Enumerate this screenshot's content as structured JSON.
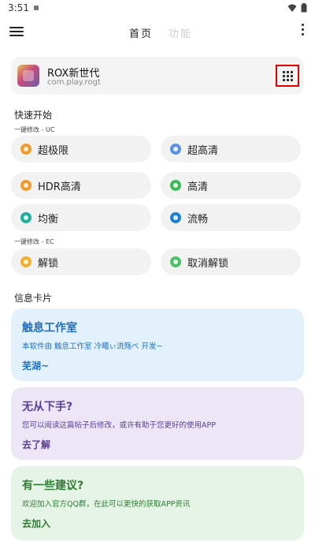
{
  "status_bar": {
    "time": "3:51"
  },
  "app_bar": {
    "tabs": [
      {
        "label": "首页"
      },
      {
        "label": "功能"
      }
    ]
  },
  "target_app": {
    "name": "ROX新世代",
    "package": "com.play.rogt"
  },
  "quick_start": {
    "title": "快速开始",
    "group_uc": {
      "label": "一键修改 - UC",
      "items": [
        {
          "label": "超极限",
          "color": "#f39a2b"
        },
        {
          "label": "超高清",
          "color": "#5b8fe8"
        },
        {
          "label": "HDR高清",
          "color": "#f39a2b"
        },
        {
          "label": "高清",
          "color": "#3dba5a"
        },
        {
          "label": "均衡",
          "color": "#1fae9a"
        },
        {
          "label": "流畅",
          "color": "#1e7fd4"
        }
      ]
    },
    "group_ec": {
      "label": "一键修改 - EC",
      "items": [
        {
          "label": "解锁",
          "color": "#f3b12b"
        },
        {
          "label": "取消解锁",
          "color": "#4cbf6a"
        }
      ]
    }
  },
  "info": {
    "title": "信息卡片",
    "cards": [
      {
        "title": "触息工作室",
        "desc": "本软件由 触息工作室 冷曦ぃ流殇べ 开发~",
        "action": "芜湖~",
        "bg": "#e3f1fd",
        "color": "#1f6fc2"
      },
      {
        "title": "无从下手?",
        "desc": "您可以阅读这篇帖子后修改，或许有助于您更好的使用APP",
        "action": "去了解",
        "bg": "#ece6f6",
        "color": "#5a3d9a"
      },
      {
        "title": "有一些建议?",
        "desc": "欢迎加入官方QQ群，在此可以更快的获取APP资讯",
        "action": "去加入",
        "bg": "#e5f4e6",
        "color": "#2e7d32"
      }
    ]
  }
}
